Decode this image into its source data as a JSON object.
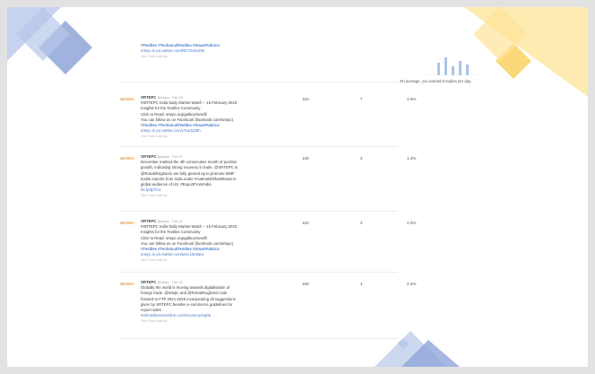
{
  "top_partial": {
    "hashtags": "#Textiles #TechnicalTextiles #SmartFabrics",
    "link": "srtepc.in pic.twitter.com/RET2HxUDB",
    "view_details": "View Tweet activity"
  },
  "tweets": [
    {
      "avatar_label": "SRTEPC",
      "author": "SRTEPC",
      "handle_date": "@srtepc · Feb 16",
      "lines": [
        {
          "text": "#SRTEPC India Daily Market Watch – 16 February 2023",
          "style": "mixed"
        },
        {
          "text": "Insights for the Textiles Community",
          "style": "plain"
        },
        {
          "text": "Click to Read: srtepc.org/gallery/viewfil",
          "style": "mixed"
        },
        {
          "text": "You can follow us on Facebook (facebook.com/srtepc).",
          "style": "mixed"
        },
        {
          "text": "#Textiles #TechnicalTextiles #SmartFabrics",
          "style": "tag"
        },
        {
          "text": "srtepc.in pic.twitter.com/yTusJyZ8h",
          "style": "link"
        }
      ],
      "view_details": "View Tweet activity",
      "impressions": "153",
      "engagements": "7",
      "engagement_rate": "4.6%"
    },
    {
      "avatar_label": "SRTEPC",
      "author": "SRTEPC",
      "handle_date": "@srtepc · Feb 17",
      "lines": [
        {
          "text": "December marked the 4th consecutive month of positive",
          "style": "plain"
        },
        {
          "text": "growth, indicating strong recovery in trade. @SRTEPC &",
          "style": "mixed"
        },
        {
          "text": "@RonakRughani1 are fully geared up to promote MMF",
          "style": "mixed"
        },
        {
          "text": "textile exports from India under #AatmaNirbharBharat to",
          "style": "mixed"
        },
        {
          "text": "global audience of US. #ExportFromIndia",
          "style": "mixed"
        },
        {
          "text": "bit.ly/3jrf7oc",
          "style": "link"
        }
      ],
      "view_details": "View Tweet activity",
      "impressions": "140",
      "engagements": "2",
      "engagement_rate": "1.4%"
    },
    {
      "avatar_label": "SRTEPC",
      "author": "SRTEPC",
      "handle_date": "@srtepc · Feb 15",
      "lines": [
        {
          "text": "#SRTEPC India Daily Market Watch – 15 February 2023",
          "style": "mixed"
        },
        {
          "text": "Insights for the Textiles Community",
          "style": "plain"
        },
        {
          "text": "Click to Read: srtepc.org/gallery/viewfil",
          "style": "mixed"
        },
        {
          "text": "You can follow us on Facebook (facebook.com/srtepc).",
          "style": "mixed"
        },
        {
          "text": "#Textiles #TechnicalTextiles #SmartFabrics",
          "style": "tag"
        },
        {
          "text": "srtepc.in pic.twitter.com/lwsc1bm8pw",
          "style": "link"
        }
      ],
      "view_details": "View Tweet activity",
      "impressions": "153",
      "engagements": "3",
      "engagement_rate": "2.0%"
    },
    {
      "avatar_label": "SRTEPC",
      "author": "SRTEPC",
      "handle_date": "@srtepc · Feb 15",
      "lines": [
        {
          "text": "Globally the world is moving towards digitalisation of",
          "style": "plain"
        },
        {
          "text": "foreign trade. @srtepc and @RonakRughani1 look",
          "style": "mixed"
        },
        {
          "text": "forward to FTP 2021-2026 incorporating all suggestions",
          "style": "plain"
        },
        {
          "text": "given by SRTEPC besides e-commerce guidelines for",
          "style": "plain"
        },
        {
          "text": "export sales",
          "style": "plain"
        },
        {
          "text": "#ahmadbusinessline.com/economy/agri&",
          "style": "link"
        }
      ],
      "view_details": "View Tweet activity",
      "impressions": "168",
      "engagements": "4",
      "engagement_rate": "2.4%"
    }
  ],
  "summary": {
    "text": "On average, you earned 8 replies per day."
  },
  "colors": {
    "blue_deco": "#8fa6d8",
    "yellow_deco": "#fde49a",
    "link": "#4a7bc5",
    "bar": "#a9c4e8"
  },
  "icons": {
    "avatar": "srtepc-logo-icon"
  }
}
